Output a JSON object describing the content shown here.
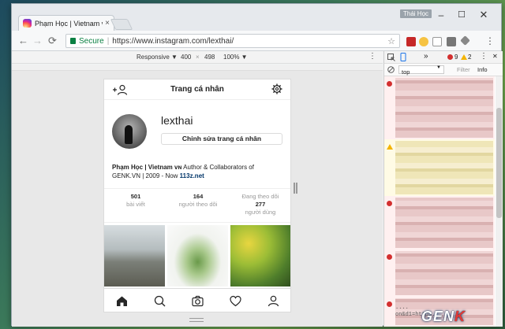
{
  "browser": {
    "tab_title": "Phạm Học | Vietnam vn",
    "tab_close": "×",
    "profile_name": "Thái Học",
    "window_min": "–",
    "window_max": "☐",
    "window_close": "✕",
    "secure_label": "Secure",
    "separator": "|",
    "url": "https://www.instagram.com/lexthai/",
    "nav_back": "←",
    "nav_forward": "→",
    "nav_reload": "⟳",
    "bookmark": "☆",
    "menu": "⋮"
  },
  "device_toolbar": {
    "mode": "Responsive ▼",
    "width": "400",
    "times": "×",
    "height": "498",
    "zoom": "100% ▼",
    "menu": "⋮"
  },
  "devtools": {
    "more_tabs": "»",
    "error_count": "9",
    "warning_count": "2",
    "menu": "⋮",
    "close": "✕",
    "context": "top",
    "filter_placeholder": "Filter",
    "level": "Info",
    "cut_text_1": "....",
    "cut_text_2": "on&d1=https..."
  },
  "instagram": {
    "page_title": "Trang cá nhân",
    "username": "lexthai",
    "edit_button": "Chỉnh sửa trang cá nhân",
    "bio_name": "Phạm Học | Vietnam vɴ",
    "bio_text": " Author & Collaborators of GENK.VN | 2009 - Now ",
    "bio_link": "113z.net",
    "stats": [
      {
        "value": "501",
        "label": "bài viết"
      },
      {
        "value": "164",
        "label": "người theo dõi"
      },
      {
        "value": "277",
        "label": "người dùng",
        "prefix": "Đang theo dõi"
      }
    ]
  },
  "watermark": {
    "text_main": "GEN",
    "text_accent": "K"
  },
  "colors": {
    "secure": "#0b8043",
    "link": "#003569",
    "error": "#d32f2f",
    "warning": "#f4b400"
  }
}
